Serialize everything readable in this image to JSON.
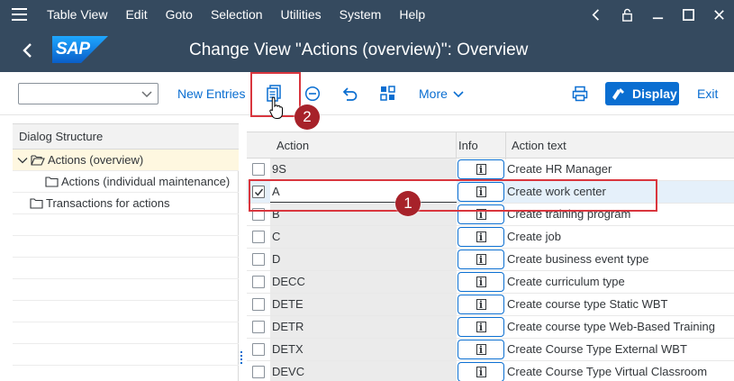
{
  "menubar": {
    "items": [
      "Table View",
      "Edit",
      "Goto",
      "Selection",
      "Utilities",
      "System",
      "Help"
    ]
  },
  "titlebar": {
    "logo_text": "SAP",
    "title": "Change View \"Actions (overview)\": Overview"
  },
  "toolbar": {
    "new_entries": "New Entries",
    "more": "More",
    "display": "Display",
    "exit": "Exit"
  },
  "annotations": {
    "badge1": "1",
    "badge2": "2"
  },
  "dialog": {
    "header": "Dialog Structure",
    "items": [
      {
        "label": "Actions (overview)"
      },
      {
        "label": "Actions (individual maintenance)"
      },
      {
        "label": "Transactions for actions"
      }
    ]
  },
  "table": {
    "headers": {
      "action": "Action",
      "info": "Info",
      "text": "Action text"
    },
    "rows": [
      {
        "action": "9S",
        "text": "Create HR Manager",
        "checked": false
      },
      {
        "action": "A",
        "text": "Create work center",
        "checked": true
      },
      {
        "action": "B",
        "text": "Create training program",
        "checked": false
      },
      {
        "action": "C",
        "text": "Create job",
        "checked": false
      },
      {
        "action": "D",
        "text": "Create business event type",
        "checked": false
      },
      {
        "action": "DECC",
        "text": "Create curriculum type",
        "checked": false
      },
      {
        "action": "DETE",
        "text": "Create course type Static WBT",
        "checked": false
      },
      {
        "action": "DETR",
        "text": "Create course type Web-Based Training",
        "checked": false
      },
      {
        "action": "DETX",
        "text": "Create Course Type External WBT",
        "checked": false
      },
      {
        "action": "DEVC",
        "text": "Create Course Type Virtual Classroom",
        "checked": false
      }
    ]
  },
  "colors": {
    "shell": "#354a5f",
    "accent": "#0a6ed1",
    "annotation": "#d9363e",
    "badge": "#a7222a"
  }
}
